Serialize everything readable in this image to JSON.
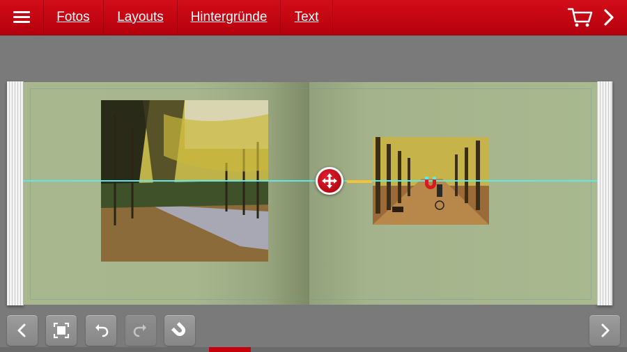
{
  "topbar": {
    "tabs": [
      {
        "label": "Fotos"
      },
      {
        "label": "Layouts"
      },
      {
        "label": "Hintergründe"
      },
      {
        "label": "Text"
      }
    ],
    "icons": {
      "menu": "hamburger-icon",
      "cart": "cart-icon",
      "next": "chevron-right-icon"
    }
  },
  "toolbar": {
    "buttons": [
      {
        "name": "back",
        "icon": "chevron-left-icon",
        "enabled": true
      },
      {
        "name": "fit",
        "icon": "fit-screen-icon",
        "enabled": true
      },
      {
        "name": "undo",
        "icon": "undo-icon",
        "enabled": true
      },
      {
        "name": "redo",
        "icon": "redo-icon",
        "enabled": false
      },
      {
        "name": "snap",
        "icon": "magnet-icon",
        "enabled": true
      },
      {
        "name": "forward",
        "icon": "chevron-right-icon",
        "enabled": true
      }
    ]
  },
  "canvas": {
    "photos": [
      {
        "subject": "tree-lined avenue with path"
      },
      {
        "subject": "avenue with cyclist and bench"
      }
    ],
    "move_handle": "move-arrows-icon",
    "snap_indicator": "magnet-icon"
  },
  "colors": {
    "brand": "#c8000f",
    "page": "#a9b88f",
    "guide": "#5fe8e8",
    "highlight": "#f2c23a"
  },
  "page_progress": {
    "fraction": 0.066
  }
}
